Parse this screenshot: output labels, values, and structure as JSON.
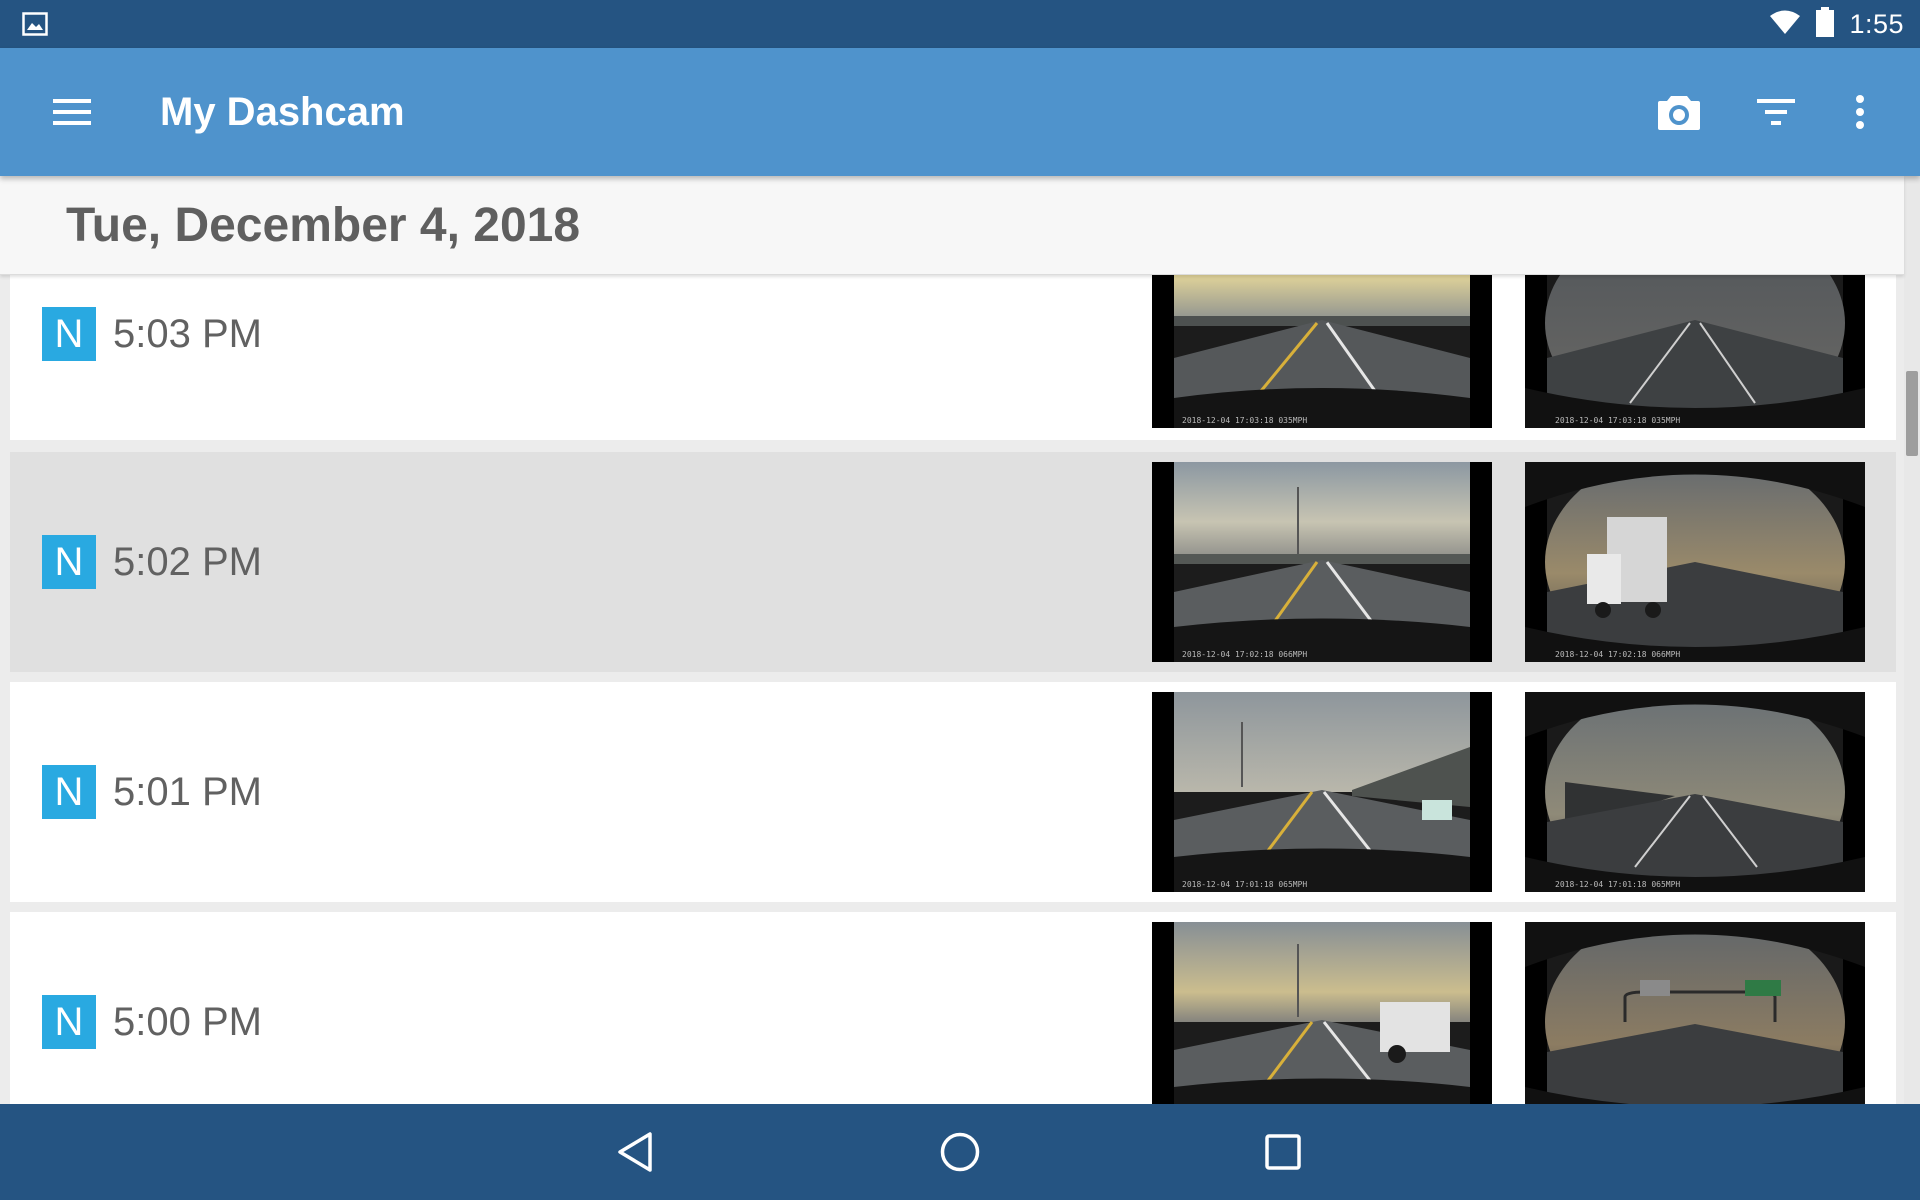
{
  "status_bar": {
    "notification_icon": "gallery-icon",
    "wifi_icon": "wifi-icon",
    "battery_icon": "battery-icon",
    "time": "1:55"
  },
  "app_bar": {
    "menu_icon": "menu-icon",
    "title": "My Dashcam",
    "actions": [
      "camera-icon",
      "filter-icon",
      "more-vert-icon"
    ],
    "color": "#4f93cc"
  },
  "date_header": "Tue, December 4, 2018",
  "recordings": [
    {
      "badge": "N",
      "time": "5:03 PM",
      "selected": false,
      "front_stamp": "2018-12-04 17:03:18 035MPH",
      "rear_stamp": "2018-12-04 17:03:18 035MPH"
    },
    {
      "badge": "N",
      "time": "5:02 PM",
      "selected": true,
      "front_stamp": "2018-12-04 17:02:18 066MPH",
      "rear_stamp": "2018-12-04 17:02:18 066MPH"
    },
    {
      "badge": "N",
      "time": "5:01 PM",
      "selected": false,
      "front_stamp": "2018-12-04 17:01:18 065MPH",
      "rear_stamp": "2018-12-04 17:01:18 065MPH"
    },
    {
      "badge": "N",
      "time": "5:00 PM",
      "selected": false,
      "front_stamp": "",
      "rear_stamp": ""
    }
  ],
  "nav_bar": [
    "back-icon",
    "home-icon",
    "recents-icon"
  ],
  "colors": {
    "badge": "#29a9e1",
    "status_bar": "#255482",
    "selected_row": "#e0e0e0"
  }
}
